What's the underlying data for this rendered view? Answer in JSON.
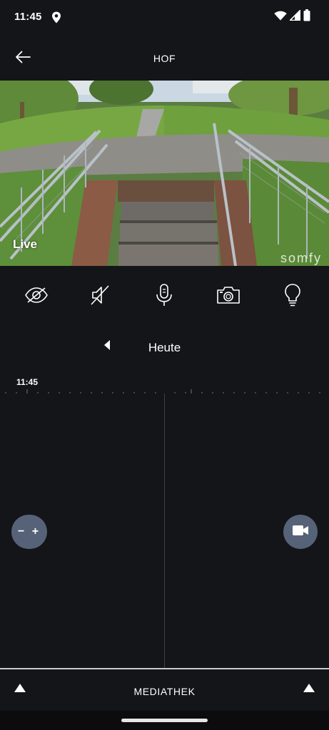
{
  "status_bar": {
    "time": "11:45",
    "icons": [
      "location-icon",
      "wifi-icon",
      "signal-icon",
      "battery-icon"
    ]
  },
  "header": {
    "title": "HOF",
    "back_icon": "arrow-left-icon"
  },
  "video": {
    "live_label": "Live",
    "brand_label": "somfy"
  },
  "controls": [
    {
      "name": "privacy-eye-slash-icon"
    },
    {
      "name": "speaker-muted-icon"
    },
    {
      "name": "microphone-icon"
    },
    {
      "name": "camera-icon"
    },
    {
      "name": "lightbulb-icon"
    }
  ],
  "timeline": {
    "day_label": "Heute",
    "time_label": "11:45",
    "prev_icon": "triangle-left-icon"
  },
  "buttons": {
    "zoom_label": "− +",
    "record_icon": "video-camera-icon"
  },
  "bottom_bar": {
    "label": "MEDIATHEK",
    "left_icon": "triangle-up-icon",
    "right_icon": "triangle-up-icon"
  },
  "colors": {
    "background": "#141518",
    "floating_button": "#566278",
    "divider": "#c8ccd2"
  }
}
